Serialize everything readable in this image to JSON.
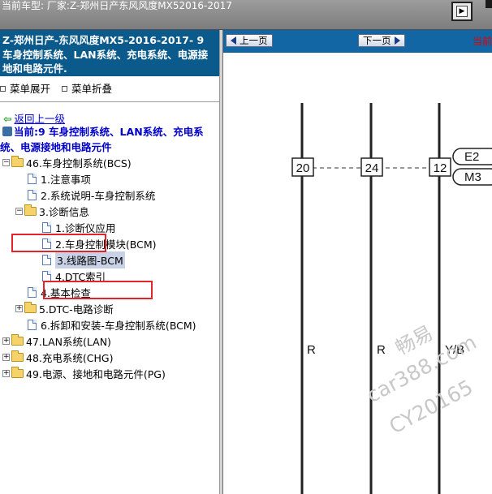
{
  "topbar": {
    "car_text": "当前车型:  厂家:Z-郑州日产东风风度MX52016-2017",
    "nav_icon": "page-forward-icon"
  },
  "left": {
    "header": "Z-郑州日产-东风风度MX5-2016-2017- 9 车身控制系统、LAN系统、充电系统、电源接地和电路元件.",
    "expand_label": "菜单展开",
    "collapse_label": "菜单折叠",
    "back_label": "返回上一级",
    "current_label": "当前:9 车身控制系统、LAN系统、充电系统、电源接地和电路元件",
    "tree": [
      {
        "label": "46.车身控制系统(BCS)"
      },
      {
        "label": "1.注意事项"
      },
      {
        "label": "2.系统说明-车身控制系统"
      },
      {
        "label": "3.诊断信息"
      },
      {
        "label": "1.诊断仪应用"
      },
      {
        "label": "2.车身控制模块(BCM)"
      },
      {
        "label": "3.线路图-BCM"
      },
      {
        "label": "4.DTC索引"
      },
      {
        "label": "4.基本检查"
      },
      {
        "label": "5.DTC-电路诊断"
      },
      {
        "label": "6.拆卸和安装-车身控制系统(BCM)"
      },
      {
        "label": "47.LAN系统(LAN)"
      },
      {
        "label": "48.充电系统(CHG)"
      },
      {
        "label": "49.电源、接地和电路元件(PG)"
      }
    ]
  },
  "right": {
    "prev_label": "上一页",
    "next_label": "下一页",
    "current_text": "当前",
    "diagram": {
      "pins": [
        "20",
        "24",
        "12"
      ],
      "connector_labels": [
        "E2",
        "M3"
      ],
      "wire_colors": [
        "R",
        "R",
        "Y/B"
      ]
    },
    "watermark": [
      "畅易",
      "car388.com",
      "CY20165"
    ]
  },
  "colors": {
    "header_bg": "#0b5a8c",
    "toolbar_bg": "#1366a4",
    "highlight": "#e0262a",
    "link": "#0000d0"
  }
}
